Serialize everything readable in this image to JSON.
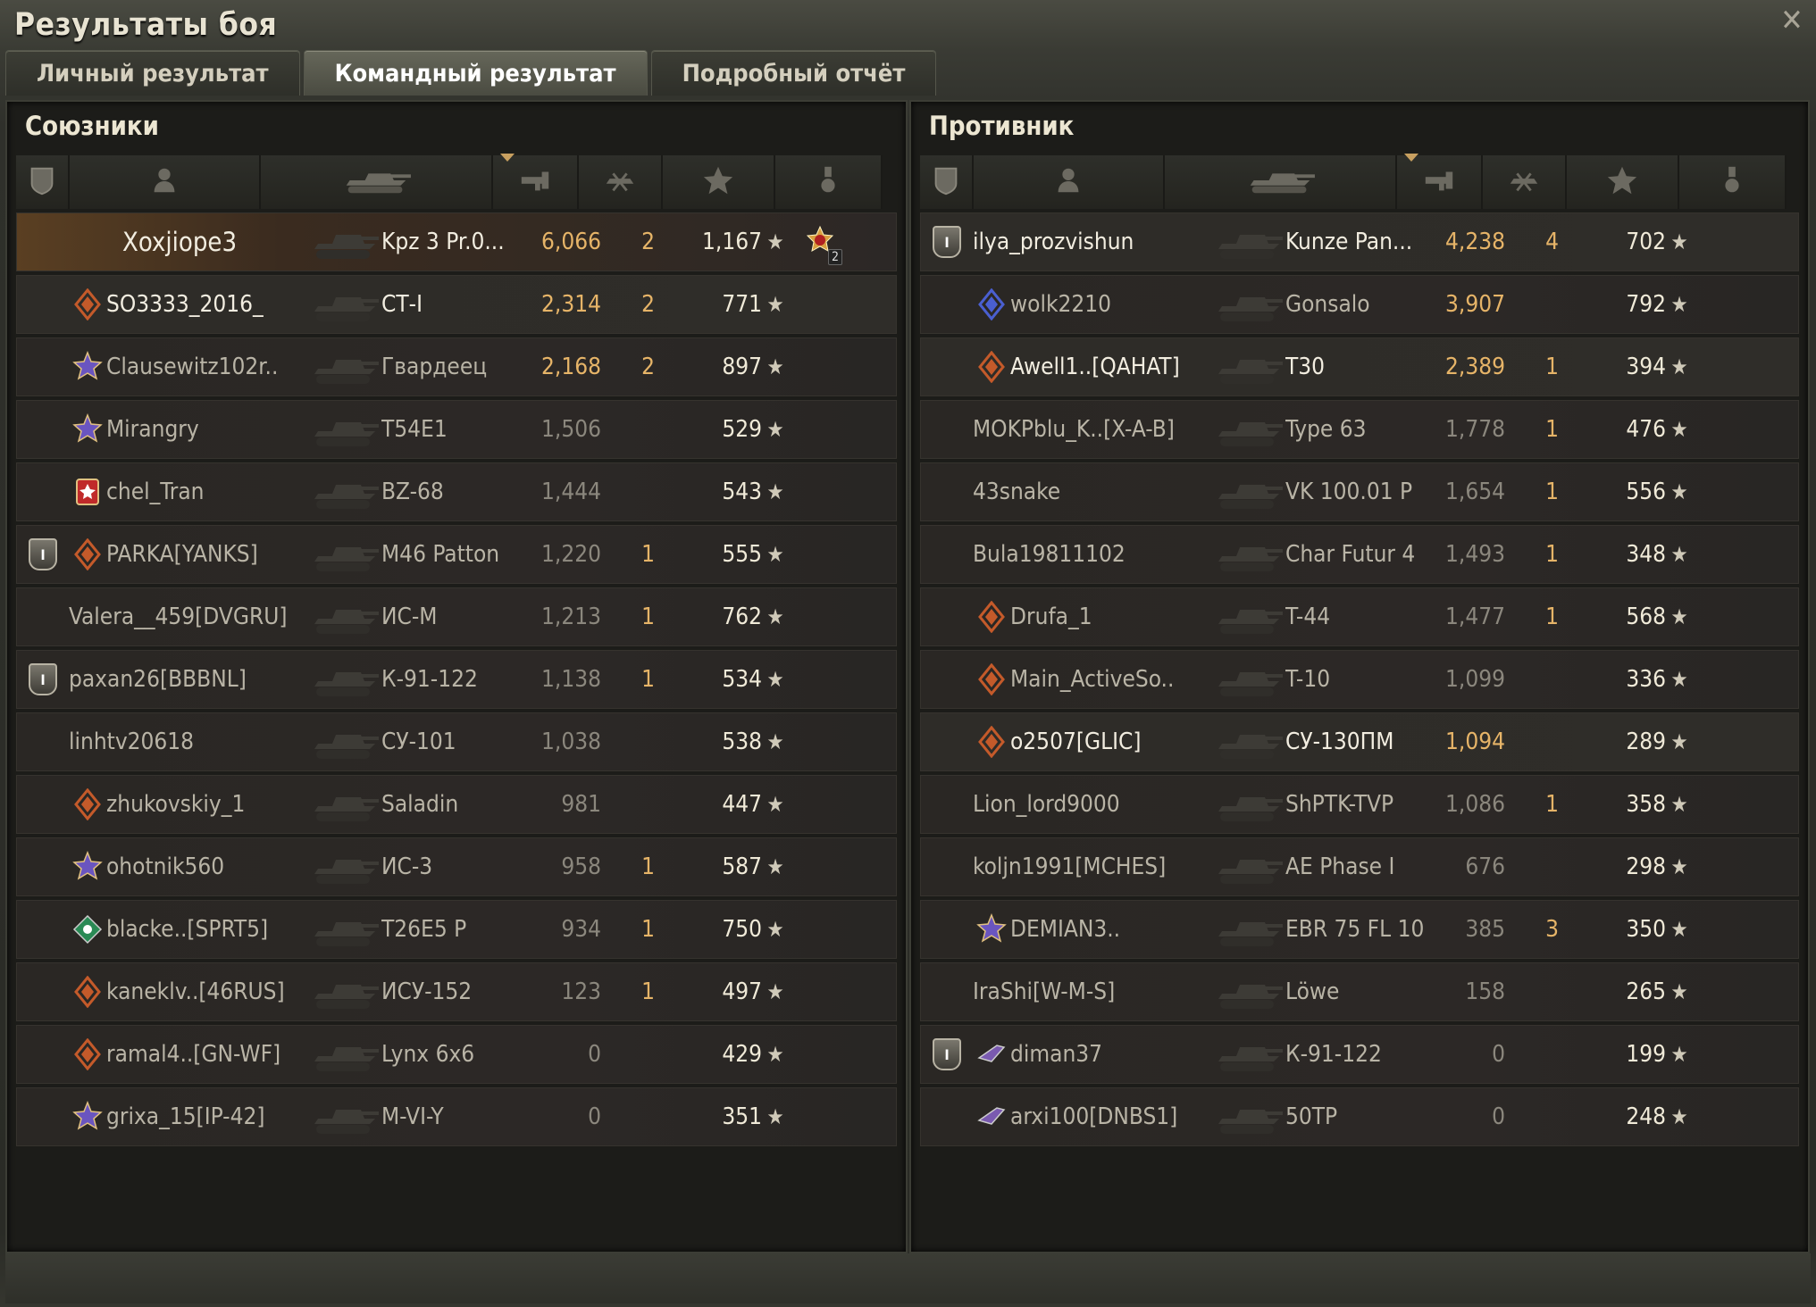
{
  "window": {
    "title": "Результаты боя",
    "close_label": "✕"
  },
  "tabs": [
    {
      "label": "Личный результат",
      "active": false
    },
    {
      "label": "Командный результат",
      "active": true
    },
    {
      "label": "Подробный отчёт",
      "active": false
    }
  ],
  "allies": {
    "title": "Союзники",
    "rows": [
      {
        "platoon": "",
        "name": "Xoxjiope3",
        "tank": "Kpz 3 Pr.0...",
        "damage": "6,066",
        "kills": "2",
        "xp": "1,167",
        "medal": true,
        "medal_count": "2",
        "me": true,
        "alive": true,
        "badge": ""
      },
      {
        "platoon": "",
        "name": "SO3333_2016_",
        "tank": "СТ-I",
        "damage": "2,314",
        "kills": "2",
        "xp": "771",
        "alive": true,
        "badge": "diamond"
      },
      {
        "platoon": "",
        "name": "Clausewitz102r..",
        "tank": "Гвардеец",
        "damage": "2,168",
        "kills": "2",
        "xp": "897",
        "alive": false,
        "badge": "star"
      },
      {
        "platoon": "",
        "name": "Mirangry",
        "tank": "T54E1",
        "damage": "1,506",
        "kills": "",
        "xp": "529",
        "alive": false,
        "badge": "star"
      },
      {
        "platoon": "",
        "name": "chel_Tran",
        "tank": "BZ-68",
        "damage": "1,444",
        "kills": "",
        "xp": "543",
        "alive": false,
        "badge": "red"
      },
      {
        "platoon": "I",
        "name": "PARKA[YANKS]",
        "tank": "M46 Patton",
        "damage": "1,220",
        "kills": "1",
        "xp": "555",
        "alive": false,
        "badge": "diamond"
      },
      {
        "platoon": "",
        "name": "Valera__459[DVGRU]",
        "tank": "ИС-М",
        "damage": "1,213",
        "kills": "1",
        "xp": "762",
        "alive": false,
        "badge": "",
        "wide": true
      },
      {
        "platoon": "I",
        "name": "paxan26[BBBNL]",
        "tank": "К-91-122",
        "damage": "1,138",
        "kills": "1",
        "xp": "534",
        "alive": false,
        "badge": "",
        "wide": true
      },
      {
        "platoon": "",
        "name": "linhtv20618",
        "tank": "СУ-101",
        "damage": "1,038",
        "kills": "",
        "xp": "538",
        "alive": false,
        "badge": "",
        "wide": true
      },
      {
        "platoon": "",
        "name": "zhukovskiy_1",
        "tank": "Saladin",
        "damage": "981",
        "kills": "",
        "xp": "447",
        "alive": false,
        "badge": "diamond"
      },
      {
        "platoon": "",
        "name": "ohotnik560",
        "tank": "ИС-3",
        "damage": "958",
        "kills": "1",
        "xp": "587",
        "alive": false,
        "badge": "star"
      },
      {
        "platoon": "",
        "name": "blacke..[SPRT5]",
        "tank": "T26E5 P",
        "damage": "934",
        "kills": "1",
        "xp": "750",
        "alive": false,
        "badge": "green"
      },
      {
        "platoon": "",
        "name": "kaneklv..[46RUS]",
        "tank": "ИСУ-152",
        "damage": "123",
        "kills": "1",
        "xp": "497",
        "alive": false,
        "badge": "diamond"
      },
      {
        "platoon": "",
        "name": "ramal4..[GN-WF]",
        "tank": "Lynx 6x6",
        "damage": "0",
        "kills": "",
        "xp": "429",
        "alive": false,
        "badge": "diamond"
      },
      {
        "platoon": "",
        "name": "grixa_15[IP-42]",
        "tank": "M-VI-Y",
        "damage": "0",
        "kills": "",
        "xp": "351",
        "alive": false,
        "badge": "star"
      }
    ]
  },
  "enemies": {
    "title": "Противник",
    "rows": [
      {
        "platoon": "I",
        "name": "ilya_prozvishun",
        "tank": "Kunze Pan...",
        "damage": "4,238",
        "kills": "4",
        "xp": "702",
        "alive": true,
        "badge": "",
        "wide": true
      },
      {
        "platoon": "",
        "name": "wolk2210",
        "tank": "Gonsalo",
        "damage": "3,907",
        "kills": "",
        "xp": "792",
        "alive": false,
        "badge": "diamondblue"
      },
      {
        "platoon": "",
        "name": "Awell1..[QAHAT]",
        "tank": "T30",
        "damage": "2,389",
        "kills": "1",
        "xp": "394",
        "alive": true,
        "badge": "diamond"
      },
      {
        "platoon": "",
        "name": "MOKPblu_K..[X-A-B]",
        "tank": "Type 63",
        "damage": "1,778",
        "kills": "1",
        "xp": "476",
        "alive": false,
        "badge": "",
        "wide": true
      },
      {
        "platoon": "",
        "name": "43snake",
        "tank": "VK 100.01 P",
        "damage": "1,654",
        "kills": "1",
        "xp": "556",
        "alive": false,
        "badge": "",
        "wide": true
      },
      {
        "platoon": "",
        "name": "Bula19811102",
        "tank": "Char Futur 4",
        "damage": "1,493",
        "kills": "1",
        "xp": "348",
        "alive": false,
        "badge": "",
        "wide": true
      },
      {
        "platoon": "",
        "name": "Drufa_1",
        "tank": "T-44",
        "damage": "1,477",
        "kills": "1",
        "xp": "568",
        "alive": false,
        "badge": "diamond"
      },
      {
        "platoon": "",
        "name": "Main_ActiveSo..",
        "tank": "T-10",
        "damage": "1,099",
        "kills": "",
        "xp": "336",
        "alive": false,
        "badge": "diamond"
      },
      {
        "platoon": "",
        "name": "o2507[GLIC]",
        "tank": "СУ-130ПМ",
        "damage": "1,094",
        "kills": "",
        "xp": "289",
        "alive": true,
        "badge": "diamond"
      },
      {
        "platoon": "",
        "name": "Lion_lord9000",
        "tank": "ShPTK-TVP",
        "damage": "1,086",
        "kills": "1",
        "xp": "358",
        "alive": false,
        "badge": "",
        "wide": true
      },
      {
        "platoon": "",
        "name": "koljn1991[MCHES]",
        "tank": "AE Phase I",
        "damage": "676",
        "kills": "",
        "xp": "298",
        "alive": false,
        "badge": "",
        "wide": true
      },
      {
        "platoon": "",
        "name": "DEMIAN3..",
        "tank": "EBR 75 FL 10",
        "damage": "385",
        "kills": "3",
        "xp": "350",
        "alive": false,
        "badge": "star"
      },
      {
        "platoon": "",
        "name": "IraShi[W-M-S]",
        "tank": "Löwe",
        "damage": "158",
        "kills": "",
        "xp": "265",
        "alive": false,
        "badge": "",
        "wide": true
      },
      {
        "platoon": "I",
        "name": "diman37",
        "tank": "К-91-122",
        "damage": "0",
        "kills": "",
        "xp": "199",
        "alive": false,
        "badge": "plane"
      },
      {
        "platoon": "",
        "name": "arxi100[DNBS1]",
        "tank": "50TP",
        "damage": "0",
        "kills": "",
        "xp": "248",
        "alive": false,
        "badge": "plane"
      }
    ]
  },
  "star_glyph": "★",
  "colors": {
    "gold": "#e6b468",
    "me_row": "#5a3f22",
    "panel_bg": "#1c1c19"
  }
}
